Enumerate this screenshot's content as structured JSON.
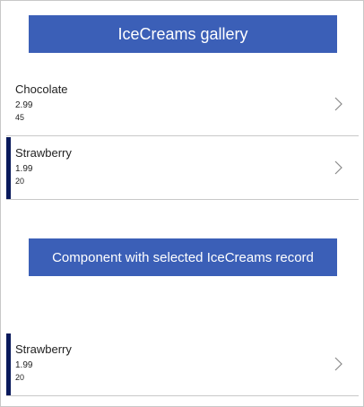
{
  "gallery": {
    "title": "IceCreams gallery",
    "items": [
      {
        "name": "Chocolate",
        "price": "2.99",
        "quantity": "45"
      },
      {
        "name": "Strawberry",
        "price": "1.99",
        "quantity": "20"
      }
    ]
  },
  "component": {
    "title": "Component with selected IceCreams record",
    "item": {
      "name": "Strawberry",
      "price": "1.99",
      "quantity": "20"
    }
  },
  "colors": {
    "header_bg": "#3b5fb7",
    "selected_indicator": "#0a1a5c"
  }
}
